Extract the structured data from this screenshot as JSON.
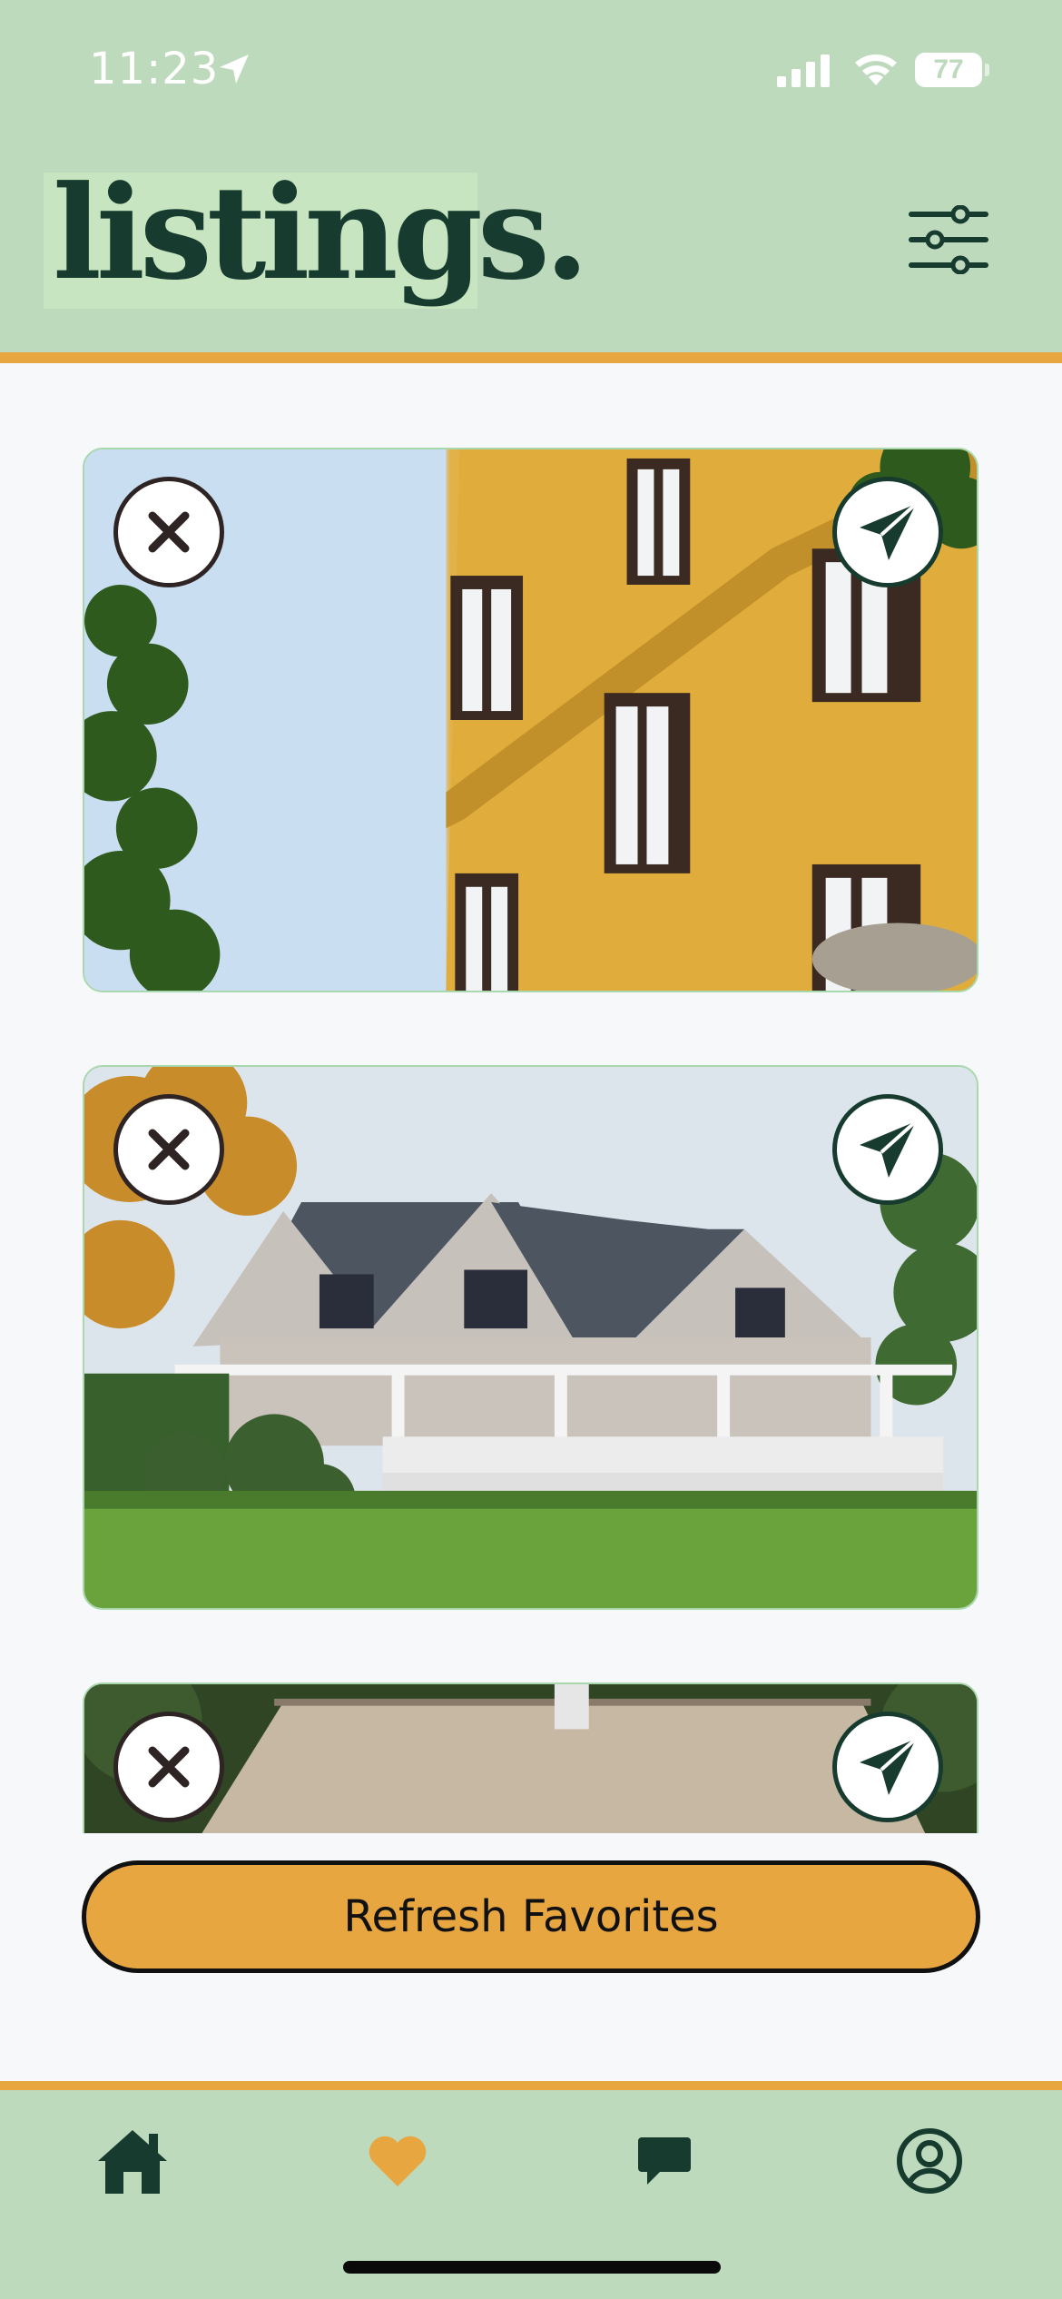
{
  "status_bar": {
    "time": "11:23",
    "battery": "77"
  },
  "header": {
    "logo_text": "listings."
  },
  "cards": [
    {
      "subject": "yellow apartment building"
    },
    {
      "subject": "grey shingle house with porch"
    },
    {
      "subject": "shingled roof house"
    }
  ],
  "actions": {
    "refresh_label": "Refresh Favorites"
  },
  "tabbar": {
    "active": "favorites",
    "tabs": [
      "home",
      "favorites",
      "messages",
      "profile"
    ]
  },
  "colors": {
    "header_bg": "#bddabd",
    "accent": "#e8a640",
    "brand_dark": "#173b2e",
    "page_bg": "#f6f8fa"
  }
}
